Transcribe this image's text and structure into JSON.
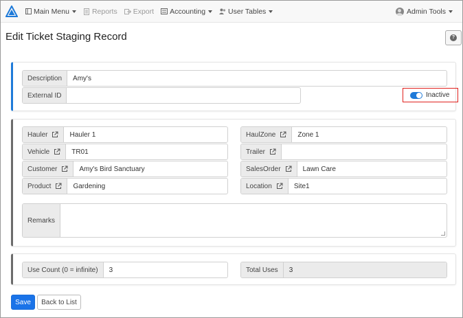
{
  "nav": {
    "main_menu": "Main Menu",
    "reports": "Reports",
    "export": "Export",
    "accounting": "Accounting",
    "user_tables": "User Tables",
    "admin_tools": "Admin Tools"
  },
  "page": {
    "title": "Edit Ticket Staging Record",
    "help_icon": "question-icon"
  },
  "record": {
    "description_label": "Description",
    "description_value": "Amy's",
    "external_id_label": "External ID",
    "external_id_value": "",
    "status_label": "Inactive"
  },
  "fields": {
    "hauler_label": "Hauler",
    "hauler_value": "Hauler 1",
    "haulzone_label": "HaulZone",
    "haulzone_value": "Zone 1",
    "vehicle_label": "Vehicle",
    "vehicle_value": "TR01",
    "trailer_label": "Trailer",
    "trailer_value": "",
    "customer_label": "Customer",
    "customer_value": "Amy's Bird Sanctuary",
    "salesorder_label": "SalesOrder",
    "salesorder_value": "Lawn Care",
    "product_label": "Product",
    "product_value": "Gardening",
    "location_label": "Location",
    "location_value": "Site1",
    "remarks_label": "Remarks",
    "remarks_value": ""
  },
  "usage": {
    "use_count_label": "Use Count (0 = infinite)",
    "use_count_value": "3",
    "total_uses_label": "Total Uses",
    "total_uses_value": "3"
  },
  "actions": {
    "save": "Save",
    "back": "Back to List"
  },
  "colors": {
    "accent": "#1e7ad9",
    "highlight_border": "#e0201c"
  }
}
